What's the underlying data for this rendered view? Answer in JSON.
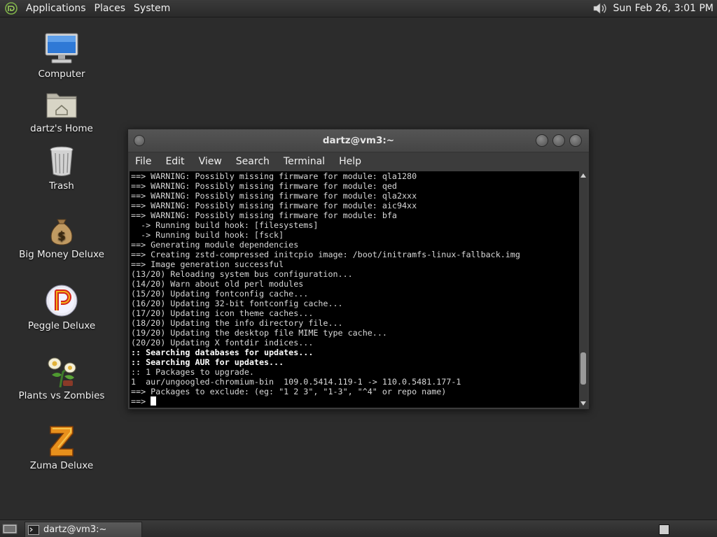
{
  "top_panel": {
    "menus": [
      "Applications",
      "Places",
      "System"
    ],
    "clock": "Sun Feb 26,  3:01 PM",
    "icons": {
      "logo": "distro-logo-icon",
      "volume": "volume-icon"
    }
  },
  "desktop_icons": [
    {
      "label": "Computer",
      "icon": "computer-icon"
    },
    {
      "label": "dartz's Home",
      "icon": "home-folder-icon"
    },
    {
      "label": "Trash",
      "icon": "trash-icon"
    },
    {
      "label": "Big Money Deluxe",
      "icon": "money-bag-icon"
    },
    {
      "label": "Peggle Deluxe",
      "icon": "peggle-icon"
    },
    {
      "label": "Plants vs Zombies",
      "icon": "plants-icon"
    },
    {
      "label": "Zuma Deluxe",
      "icon": "zuma-icon"
    }
  ],
  "terminal": {
    "title": "dartz@vm3:~",
    "menu": [
      "File",
      "Edit",
      "View",
      "Search",
      "Terminal",
      "Help"
    ],
    "lines": [
      {
        "text": "==> WARNING: Possibly missing firmware for module: qla1280",
        "bold": false
      },
      {
        "text": "==> WARNING: Possibly missing firmware for module: qed",
        "bold": false
      },
      {
        "text": "==> WARNING: Possibly missing firmware for module: qla2xxx",
        "bold": false
      },
      {
        "text": "==> WARNING: Possibly missing firmware for module: aic94xx",
        "bold": false
      },
      {
        "text": "==> WARNING: Possibly missing firmware for module: bfa",
        "bold": false
      },
      {
        "text": "  -> Running build hook: [filesystems]",
        "bold": false
      },
      {
        "text": "  -> Running build hook: [fsck]",
        "bold": false
      },
      {
        "text": "==> Generating module dependencies",
        "bold": false
      },
      {
        "text": "==> Creating zstd-compressed initcpio image: /boot/initramfs-linux-fallback.img",
        "bold": false
      },
      {
        "text": "==> Image generation successful",
        "bold": false
      },
      {
        "text": "(13/20) Reloading system bus configuration...",
        "bold": false
      },
      {
        "text": "(14/20) Warn about old perl modules",
        "bold": false
      },
      {
        "text": "(15/20) Updating fontconfig cache...",
        "bold": false
      },
      {
        "text": "(16/20) Updating 32-bit fontconfig cache...",
        "bold": false
      },
      {
        "text": "(17/20) Updating icon theme caches...",
        "bold": false
      },
      {
        "text": "(18/20) Updating the info directory file...",
        "bold": false
      },
      {
        "text": "(19/20) Updating the desktop file MIME type cache...",
        "bold": false
      },
      {
        "text": "(20/20) Updating X fontdir indices...",
        "bold": false
      },
      {
        "text": ":: Searching databases for updates...",
        "bold": true
      },
      {
        "text": ":: Searching AUR for updates...",
        "bold": true
      },
      {
        "text": ":: 1 Packages to upgrade.",
        "bold": false
      },
      {
        "text": "1  aur/ungoogled-chromium-bin  109.0.5414.119-1 -> 110.0.5481.177-1",
        "bold": false
      },
      {
        "text": "==> Packages to exclude: (eg: \"1 2 3\", \"1-3\", \"^4\" or repo name)",
        "bold": false
      }
    ],
    "prompt": "==> ",
    "scroll_position": 0.92
  },
  "bottom_panel": {
    "task_label": "dartz@vm3:~",
    "icons": {
      "show_desktop": "show-desktop-icon",
      "task": "terminal-icon",
      "workspace": "workspace-switcher-icon"
    }
  }
}
